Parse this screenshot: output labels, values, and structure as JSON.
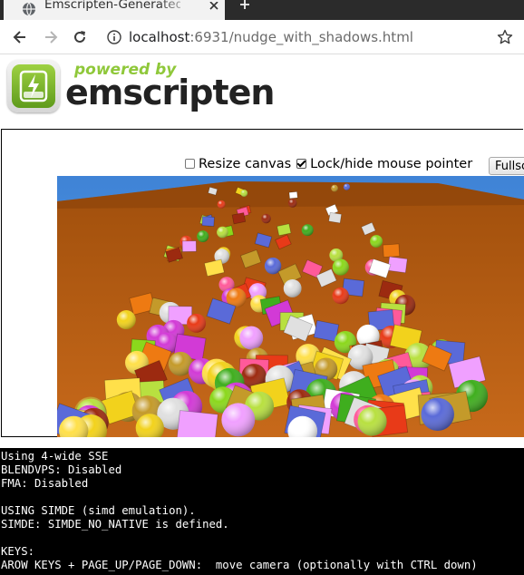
{
  "browser": {
    "tab_title": "Emscripten-Generated Code",
    "url_host": "localhost",
    "url_port": ":6931",
    "url_path": "/nudge_with_shadows.html"
  },
  "logo": {
    "tagline": "powered by",
    "wordmark": "emscripten"
  },
  "controls": {
    "resize_canvas_label": "Resize canvas",
    "resize_canvas_checked": false,
    "lock_pointer_label": "Lock/hide mouse pointer",
    "lock_pointer_checked": true,
    "fullscreen_label": "Fullscreen"
  },
  "console": {
    "lines": [
      "Using 4-wide SSE",
      "BLENDVPS: Disabled",
      "FMA: Disabled",
      "",
      "USING SIMDE (simd emulation).",
      "SIMDE: SIMDE_NO_NATIVE is defined.",
      "",
      "KEYS:",
      "AROW KEYS + PAGE_UP/PAGE_DOWN:  move camera (optionally with CTRL down)"
    ]
  },
  "colors": {
    "accent_green": "#8fc83a",
    "console_bg": "#000000",
    "scene_ground": "#b85e10"
  }
}
